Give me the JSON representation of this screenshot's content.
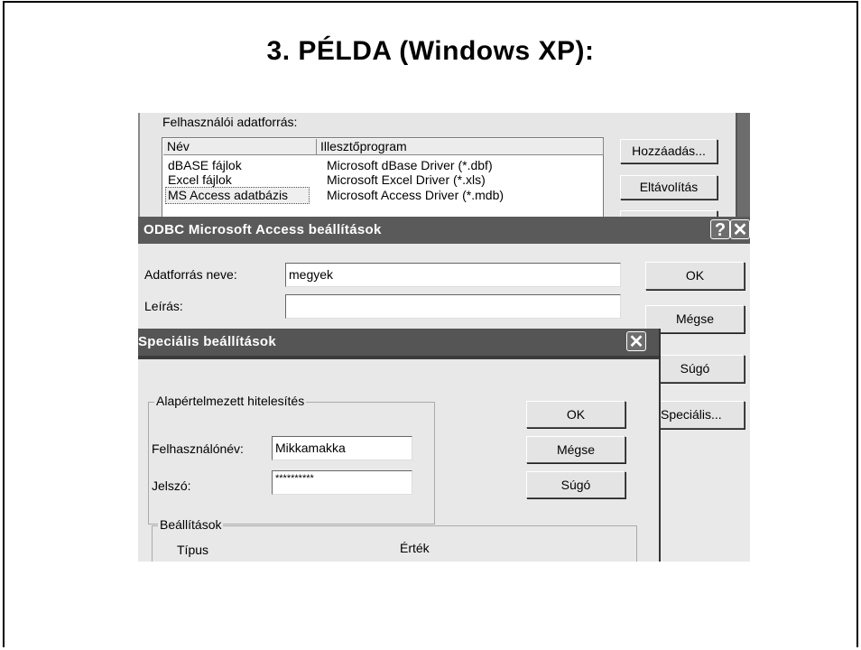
{
  "slide": {
    "title": "3. PÉLDA  (Windows XP):"
  },
  "background_window": {
    "section_label": "Felhasználói adatforrás:",
    "columns": [
      "Név",
      "Illesztőprogram"
    ],
    "rows": [
      {
        "name": "dBASE fájlok",
        "driver": "Microsoft dBase Driver (*.dbf)"
      },
      {
        "name": "Excel fájlok",
        "driver": "Microsoft Excel Driver (*.xls)"
      },
      {
        "name": "MS Access adatbázis",
        "driver": "Microsoft Access Driver (*.mdb)"
      }
    ],
    "add_button": "Hozzáadás...",
    "remove_button": "Eltávolítás"
  },
  "odbc_dialog": {
    "title": "ODBC Microsoft Access beállítások",
    "help_glyph": "?",
    "close_glyph": "✕",
    "datasource_label": "Adatforrás neve:",
    "datasource_value": "megyek",
    "description_label": "Leírás:",
    "description_value": "",
    "ok": "OK",
    "cancel": "Mégse",
    "help": "Súgó",
    "advanced": "Speciális..."
  },
  "advanced_dialog": {
    "title": "Speciális beállítások",
    "close_glyph": "✕",
    "auth_group": "Alapértelmezett hitelesítés",
    "username_label": "Felhasználónév:",
    "username_value": "Mikkamakka",
    "password_label": "Jelszó:",
    "password_value": "**********",
    "ok": "OK",
    "cancel": "Mégse",
    "help": "Súgó",
    "settings_group": "Beállítások",
    "type_col": "Típus",
    "value_col": "Érték"
  }
}
